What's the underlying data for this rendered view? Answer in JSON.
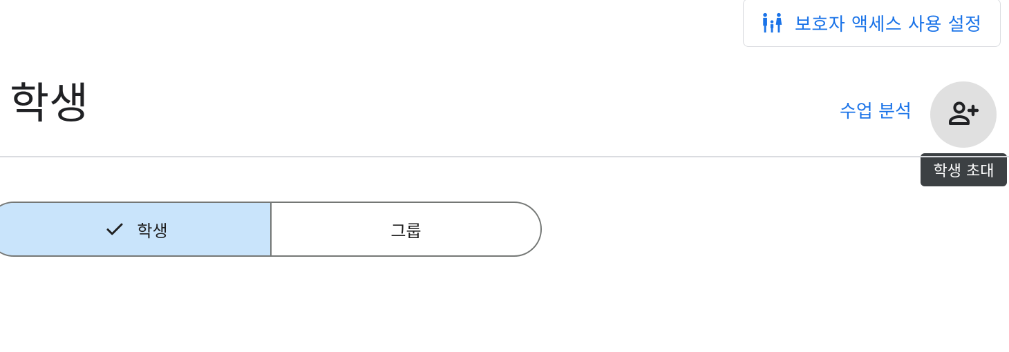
{
  "header": {
    "guardian_button_label": "보호자 액세스 사용 설정",
    "guardian_icon": "family-icon"
  },
  "main": {
    "title": "학생",
    "analytics_link": "수업 분석",
    "invite_icon": "person-add-icon",
    "invite_tooltip": "학생 초대"
  },
  "tabs": {
    "items": [
      {
        "label": "학생",
        "selected": true
      },
      {
        "label": "그룹",
        "selected": false
      }
    ]
  },
  "colors": {
    "accent": "#1a73e8",
    "selected_segment": "#c9e4fb",
    "tooltip_bg": "#3c4043",
    "invite_bg": "#e0e0e0"
  }
}
